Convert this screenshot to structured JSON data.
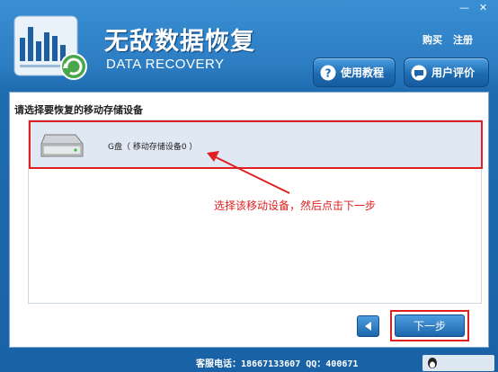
{
  "window": {
    "minimize_glyph": "—",
    "close_glyph": "✕"
  },
  "header": {
    "title": "无敌数据恢复",
    "subtitle": "DATA RECOVERY",
    "buy_label": "购买",
    "register_label": "注册",
    "tutorial_label": "使用教程",
    "review_label": "用户评价"
  },
  "main": {
    "heading": "请选择要恢复的移动存储设备",
    "devices": [
      {
        "label": "G盘（ 移动存储设备0 ）",
        "icon": "removable-drive-icon",
        "selected": true
      }
    ],
    "annotation": "选择该移动设备，然后点击下一步"
  },
  "nav": {
    "next_label": "下一步",
    "back_icon": "arrow-left-icon"
  },
  "footer": {
    "contact": "客服电话：18667133607  QQ：400671"
  },
  "colors": {
    "accent_blue": "#1f6cb1",
    "highlight_red": "#e02020",
    "selected_row": "#dfe8f3"
  }
}
